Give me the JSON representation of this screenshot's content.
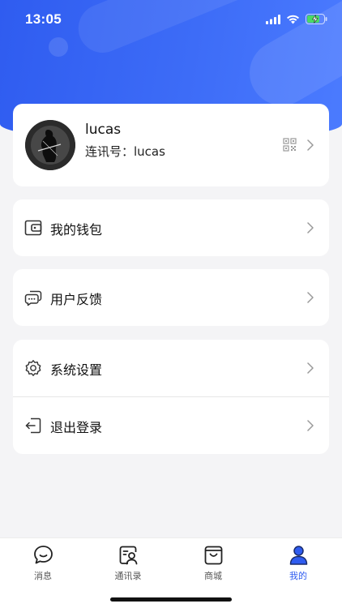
{
  "status_bar": {
    "time": "13:05"
  },
  "profile": {
    "name": "lucas",
    "account_id": "连讯号：lucas"
  },
  "menu": {
    "wallet": "我的钱包",
    "feedback": "用户反馈",
    "settings": "系统设置",
    "logout": "退出登录"
  },
  "tabs": [
    {
      "label": "消息",
      "icon": "chat-bubble-icon"
    },
    {
      "label": "通讯录",
      "icon": "contacts-icon"
    },
    {
      "label": "商城",
      "icon": "shopping-bag-icon"
    },
    {
      "label": "我的",
      "icon": "user-profile-icon",
      "active": true
    }
  ],
  "colors": {
    "accent": "#2f5cf0",
    "background": "#f4f4f6"
  }
}
